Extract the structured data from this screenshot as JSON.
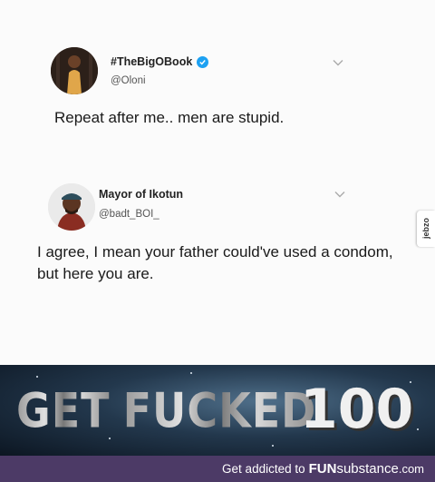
{
  "tweet1": {
    "display_name": "#TheBigOBook",
    "handle": "@Oloni",
    "text": "Repeat after me.. men are stupid."
  },
  "tweet2": {
    "display_name": "Mayor of Ikotun",
    "handle": "@badt_BOI_",
    "text": "I agree, I mean your father could've used a condom, but here you are."
  },
  "watermark": {
    "side_logo": "jebzo"
  },
  "meme": {
    "word1": "GET",
    "word2": "FUCKED",
    "score": "100"
  },
  "footer": {
    "prefix": "Get addicted to",
    "brand_bold": "FUN",
    "brand_light": "substance",
    "brand_tld": ".com"
  },
  "colors": {
    "verified": "#1da1f2",
    "footer_bg": "#4c3a66"
  },
  "icons": [
    "verified-badge-icon",
    "chevron-down-icon"
  ]
}
